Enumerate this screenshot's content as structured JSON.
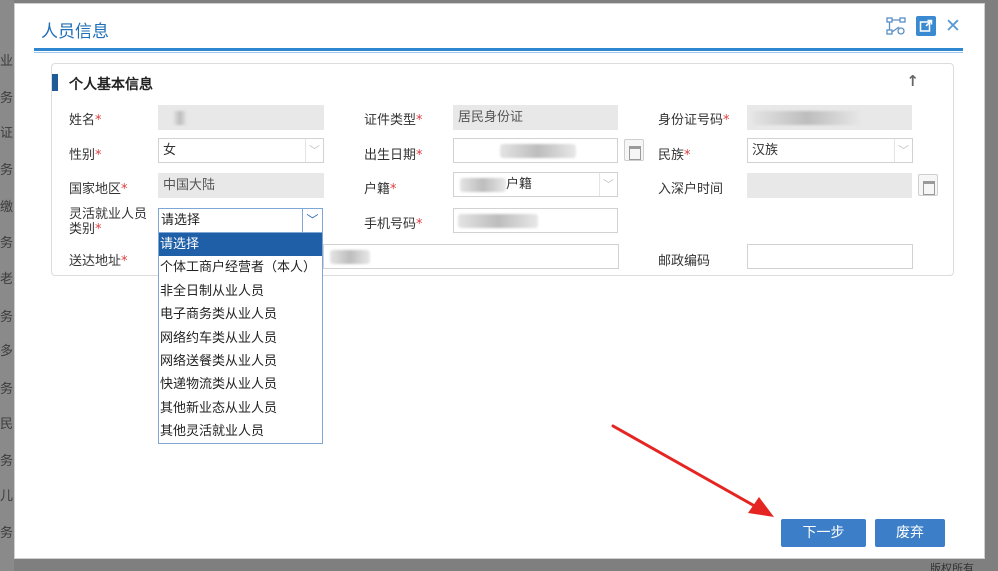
{
  "background": {
    "fragments": [
      "业",
      "务",
      "证",
      "务",
      "缴",
      "务",
      "老",
      "务",
      "多",
      "务",
      "民",
      "务",
      "儿",
      "务"
    ],
    "bottom_text": "版权所有"
  },
  "dialog": {
    "title": "人员信息",
    "icons": {
      "tree": "tree-view-icon",
      "popout": "popout-icon",
      "close": "close-icon"
    }
  },
  "section": {
    "title": "个人基本信息",
    "collapse_icon": "arrow-up-icon"
  },
  "form": {
    "name_label": "姓名",
    "id_type_label": "证件类型",
    "id_type_value": "居民身份证",
    "id_number_label": "身份证号码",
    "gender_label": "性别",
    "gender_value": "女",
    "birth_label": "出生日期",
    "ethnicity_label": "民族",
    "ethnicity_value": "汉族",
    "country_label": "国家地区",
    "country_value": "中国大陆",
    "household_label": "户籍",
    "household_suffix": "户籍",
    "sz_date_label": "入深户时间",
    "flex_type_label_1": "灵活就业人员",
    "flex_type_label_2": "类别",
    "flex_type_value": "请选择",
    "phone_label": "手机号码",
    "address_label": "送达地址",
    "postcode_label": "邮政编码",
    "required_mark": "*"
  },
  "dropdown_options": [
    "请选择",
    "个体工商户经营者（本人）",
    "非全日制从业人员",
    "电子商务类从业人员",
    "网络约车类从业人员",
    "网络送餐类从业人员",
    "快递物流类从业人员",
    "其他新业态从业人员",
    "其他灵活就业人员"
  ],
  "buttons": {
    "next": "下一步",
    "discard": "废弃"
  },
  "colors": {
    "accent": "#3c7fc8",
    "title": "#1f6fb8",
    "required": "#e03b3b",
    "arrow": "#e52521"
  }
}
